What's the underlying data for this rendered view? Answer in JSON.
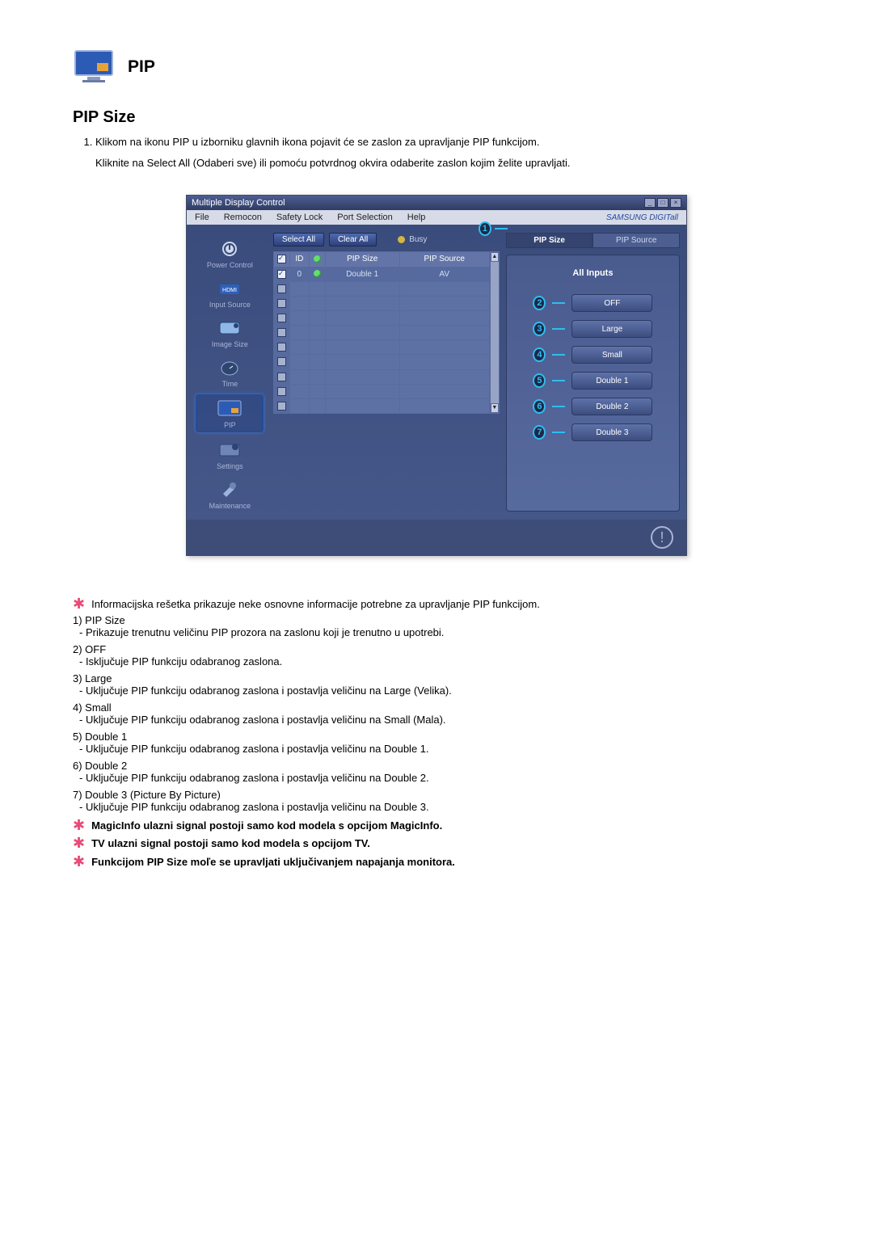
{
  "header": {
    "title": "PIP",
    "section": "PIP Size"
  },
  "intro": {
    "item1": "Klikom na ikonu PIP u izborniku glavnih ikona pojavit će se zaslon za upravljanje PIP funkcijom.",
    "item1_sub": "Kliknite na Select All (Odaberi sve) ili pomoću potvrdnog okvira odaberite zaslon kojim želite upravljati."
  },
  "app": {
    "title": "Multiple Display Control",
    "menus": [
      "File",
      "Remocon",
      "Safety Lock",
      "Port Selection",
      "Help"
    ],
    "brand": "SAMSUNG DIGITall",
    "sidebar": [
      {
        "label": "Power Control"
      },
      {
        "label": "Input Source"
      },
      {
        "label": "Image Size"
      },
      {
        "label": "Time"
      },
      {
        "label": "PIP"
      },
      {
        "label": "Settings"
      },
      {
        "label": "Maintenance"
      }
    ],
    "buttons": {
      "select_all": "Select All",
      "clear_all": "Clear All",
      "busy": "Busy"
    },
    "table": {
      "headers": {
        "chk": "",
        "id": "ID",
        "lamp": "",
        "size": "PIP Size",
        "source": "PIP Source"
      },
      "row": {
        "id": "0",
        "size": "Double 1",
        "source": "AV"
      }
    },
    "panel": {
      "tabs": {
        "size": "PIP Size",
        "source": "PIP Source"
      },
      "subtitle": "All Inputs",
      "options": [
        "OFF",
        "Large",
        "Small",
        "Double 1",
        "Double 2",
        "Double 3"
      ]
    }
  },
  "notes": {
    "info": "Informacijska rešetka prikazuje neke osnovne informacije potrebne za upravljanje PIP funkcijom.",
    "items": [
      {
        "lbl": "1)  PIP Size",
        "desc": "- Prikazuje trenutnu veličinu PIP prozora na zaslonu koji je trenutno u upotrebi."
      },
      {
        "lbl": "2)  OFF",
        "desc": "- Isključuje PIP funkciju odabranog zaslona."
      },
      {
        "lbl": "3)  Large",
        "desc": "- Uključuje PIP funkciju odabranog zaslona i postavlja veličinu na Large (Velika)."
      },
      {
        "lbl": "4)  Small",
        "desc": "- Uključuje PIP funkciju odabranog zaslona i postavlja veličinu na Small (Mala)."
      },
      {
        "lbl": "5)  Double 1",
        "desc": "- Uključuje PIP funkciju odabranog zaslona i postavlja veličinu na Double 1."
      },
      {
        "lbl": "6)  Double 2",
        "desc": "- Uključuje PIP funkciju odabranog zaslona i postavlja veličinu na Double 2."
      },
      {
        "lbl": "7)  Double 3 (Picture By Picture)",
        "desc": "- Uključuje PIP funkciju odabranog zaslona i postavlja veličinu na Double 3."
      }
    ],
    "bold1": "MagicInfo ulazni signal postoji samo kod modela s opcijom MagicInfo.",
    "bold2": "TV ulazni signal postoji samo kod modela s opcijom TV.",
    "bold3": "Funkcijom PIP Size moľe se upravljati uključivanjem napajanja monitora."
  }
}
